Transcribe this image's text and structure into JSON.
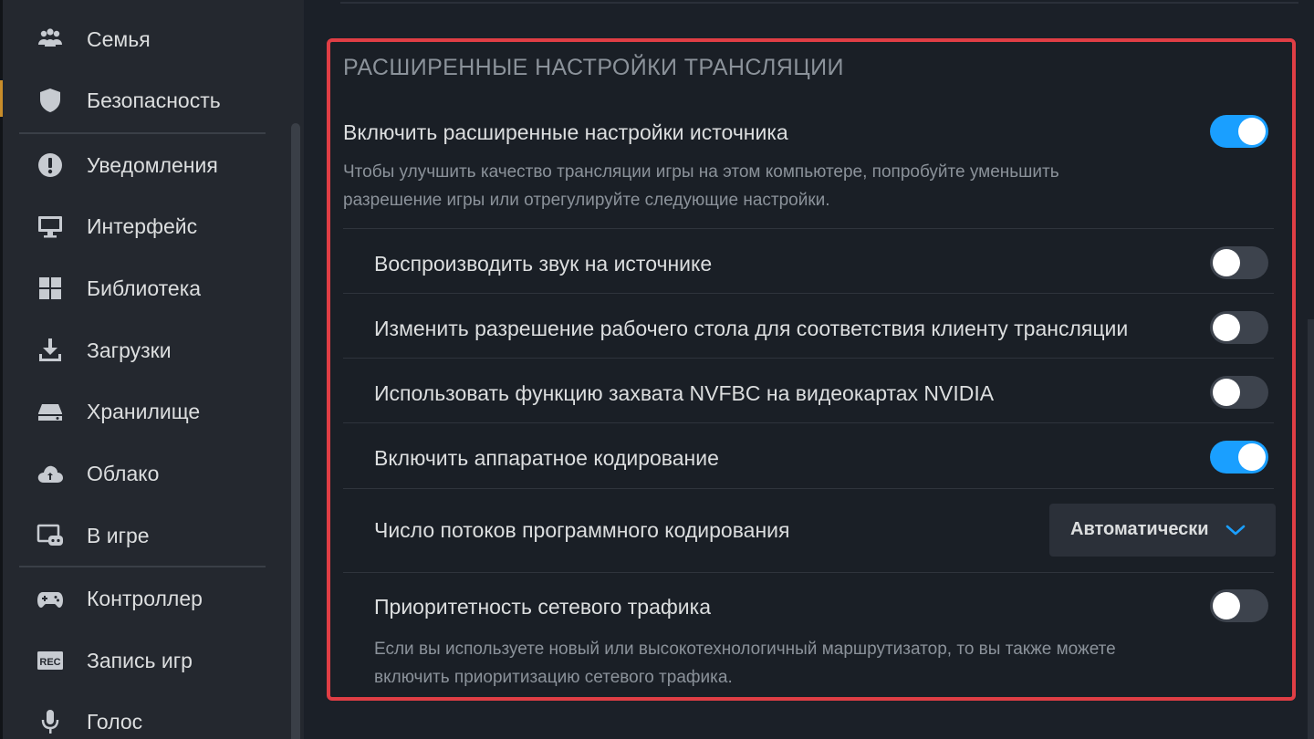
{
  "sidebar": {
    "items": [
      {
        "label": "Семья",
        "icon": "family-icon"
      },
      {
        "label": "Безопасность",
        "icon": "shield-icon"
      },
      {
        "label": "Уведомления",
        "icon": "alert-icon"
      },
      {
        "label": "Интерфейс",
        "icon": "monitor-icon"
      },
      {
        "label": "Библиотека",
        "icon": "grid-icon"
      },
      {
        "label": "Загрузки",
        "icon": "download-icon"
      },
      {
        "label": "Хранилище",
        "icon": "drive-icon"
      },
      {
        "label": "Облако",
        "icon": "cloud-icon"
      },
      {
        "label": "В игре",
        "icon": "ingame-icon"
      },
      {
        "label": "Контроллер",
        "icon": "gamepad-icon"
      },
      {
        "label": "Запись игр",
        "icon": "rec-icon"
      },
      {
        "label": "Голос",
        "icon": "microphone-icon"
      }
    ],
    "rec_badge": "REC"
  },
  "panel": {
    "title": "РАСШИРЕННЫЕ НАСТРОЙКИ ТРАНСЛЯЦИИ",
    "enable_advanced": {
      "label": "Включить расширенные настройки источника",
      "on": true
    },
    "enable_advanced_desc_line1": "Чтобы улучшить качество трансляции игры на этом компьютере, попробуйте уменьшить",
    "enable_advanced_desc_line2": "разрешение игры или отрегулируйте следующие настройки.",
    "settings": [
      {
        "label": "Воспроизводить звук на источнике",
        "on": false
      },
      {
        "label": "Изменить разрешение рабочего стола для соответствия клиенту трансляции",
        "on": false
      },
      {
        "label": "Использовать функцию захвата NVFBC на видеокартах NVIDIA",
        "on": false
      },
      {
        "label": "Включить аппаратное кодирование",
        "on": true
      }
    ],
    "threads": {
      "label": "Число потоков программного кодирования",
      "value": "Автоматически"
    },
    "priority": {
      "label": "Приоритетность сетевого трафика",
      "on": false,
      "desc_line1": "Если вы используете новый или высокотехнологичный маршрутизатор, то вы также можете",
      "desc_line2": "включить приоритизацию сетевого трафика."
    }
  },
  "colors": {
    "accent": "#1a9fff",
    "highlight_border": "#e03e45",
    "sidebar_bg": "#24282f",
    "panel_bg": "#1a1f26"
  }
}
